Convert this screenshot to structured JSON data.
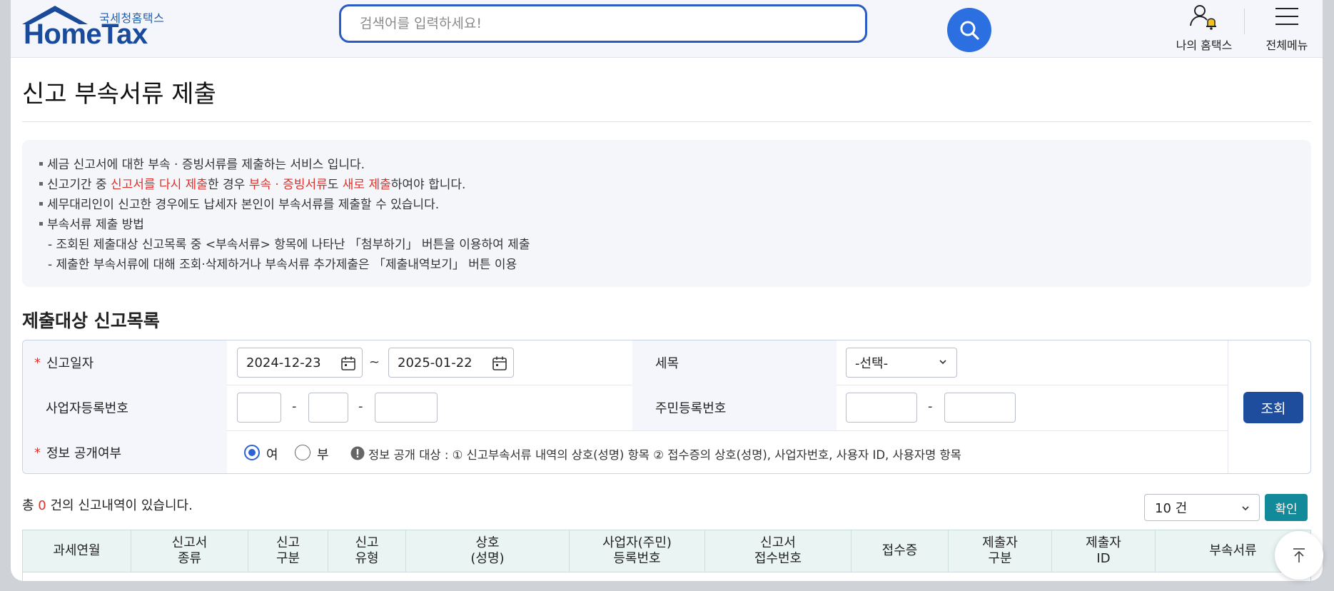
{
  "header": {
    "logo_sub": "국세청홈택스",
    "logo_main": "HomeTax",
    "search_placeholder": "검색어를 입력하세요!",
    "my_hometax_label": "나의 홈택스",
    "all_menu_label": "전체메뉴"
  },
  "page": {
    "title": "신고 부속서류 제출"
  },
  "info": {
    "line1": "세금 신고서에 대한 부속 · 증빙서류를 제출하는 서비스 입니다.",
    "line2": {
      "p1": "신고기간 중 ",
      "r1": "신고서를 다시 제출",
      "p2": "한 경우 ",
      "r2": "부속 · 증빙서류",
      "p3": "도 ",
      "r3": "새로 제출",
      "p4": "하여야 합니다."
    },
    "line3": "세무대리인이 신고한 경우에도 납세자 본인이 부속서류를 제출할 수 있습니다.",
    "line4": "부속서류 제출 방법",
    "line5": "- 조회된 제출대상 신고목록 중 <부속서류> 항목에 나타난 「첨부하기」 버튼을 이용하여 제출",
    "line6": "- 제출한 부속서류에 대해 조회·삭제하거나 부속서류 추가제출은 「제출내역보기」 버튼 이용"
  },
  "section": {
    "title": "제출대상 신고목록"
  },
  "form": {
    "report_date_label": "신고일자",
    "date_from": "2024-12-23",
    "date_sep": "~",
    "date_to": "2025-01-22",
    "tax_item_label": "세목",
    "tax_item_value": "-선택-",
    "biz_no_label": "사업자등록번호",
    "resident_no_label": "주민등록번호",
    "dash": "-",
    "disclosure_label": "정보 공개여부",
    "radio_yes": "여",
    "radio_no": "부",
    "disclosure_selected": "여",
    "disclosure_note": "정보 공개 대상 : ① 신고부속서류 내역의 상호(성명) 항목 ② 접수증의 상호(성명), 사업자번호, 사용자 ID, 사용자명 항목",
    "search_button": "조회"
  },
  "results": {
    "total_prefix": "총 ",
    "total_count": "0",
    "total_suffix": " 건의 신고내역이 있습니다.",
    "page_size": "10 건",
    "confirm_button": "확인"
  },
  "table": {
    "headers": [
      "과세연월",
      "신고서\n종류",
      "신고\n구분",
      "신고\n유형",
      "상호\n(성명)",
      "사업자(주민)\n등록번호",
      "신고서\n접수번호",
      "접수증",
      "제출자\n구분",
      "제출자\nID",
      "부속서류"
    ]
  },
  "colors": {
    "brand_blue": "#1a4a9a",
    "search_blue": "#2b6fe0",
    "accent_red": "#e0302a",
    "search_button": "#1f4d9e",
    "confirm_teal": "#138a9a",
    "table_header_bg": "#e9f4f3"
  },
  "icons": {
    "search": "magnifier-icon",
    "my_hometax": "user-bell-icon",
    "all_menu": "hamburger-icon",
    "calendar": "calendar-icon",
    "top": "arrow-up-icon"
  }
}
